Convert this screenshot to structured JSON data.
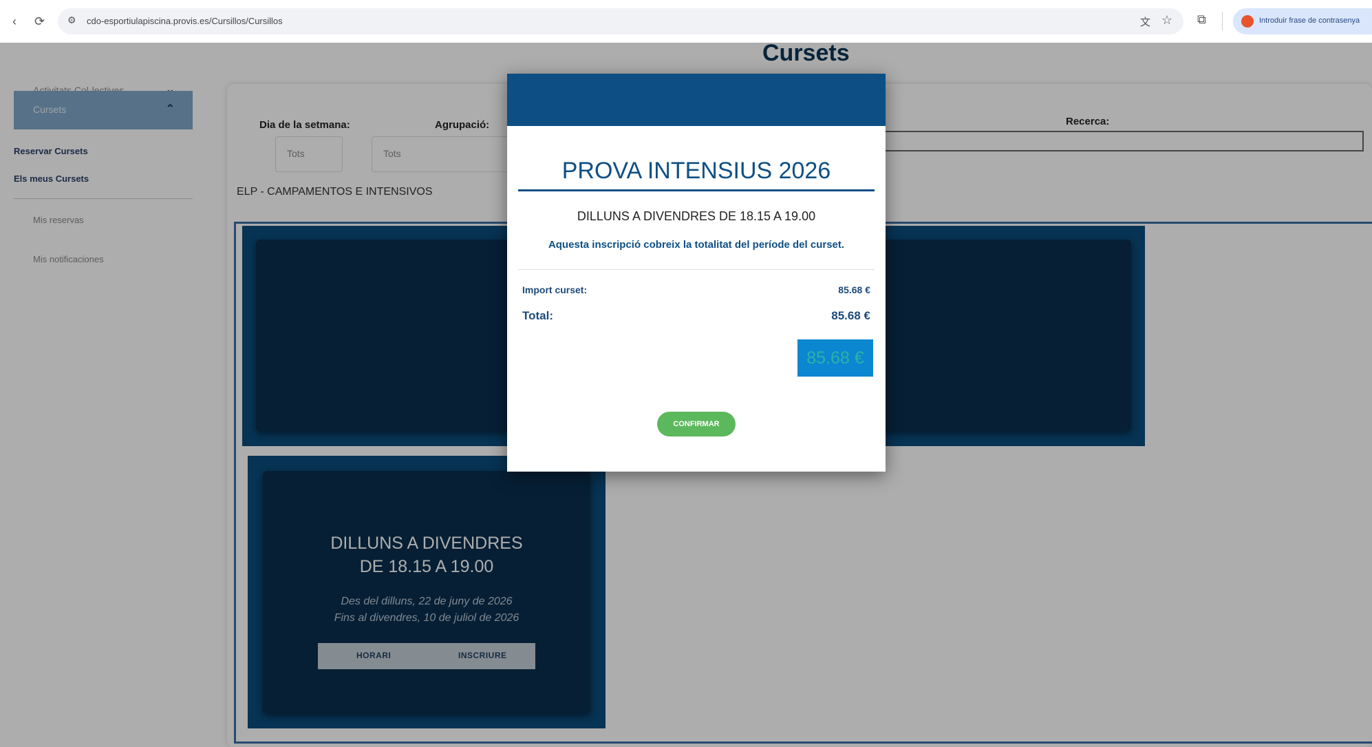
{
  "browser": {
    "url": "cdo-esportiulapiscina.provis.es/Cursillos/Cursillos",
    "profile_text": "Introduir frase de contrasenya"
  },
  "sidebar": {
    "items": [
      {
        "label": "Activitats Col·lectives"
      },
      {
        "label": "Cursets"
      }
    ],
    "subitems": [
      "Reservar Cursets",
      "Els meus Cursets"
    ],
    "links": [
      "Mis reservas",
      "Mis notificaciones"
    ]
  },
  "page": {
    "title": "Cursets",
    "filters": {
      "day_label": "Dia de la setmana:",
      "day_value": "Tots",
      "group_label": "Agrupació:",
      "group_value": "Tots",
      "search_label": "Recerca:"
    },
    "group_title": "ELP - CAMPAMENTOS E INTENSIVOS",
    "card": {
      "title_line1": "DILLUNS A DIVENDRES",
      "title_line2": "DE 18.15 A 19.00",
      "date_from": "Des del dilluns, 22 de juny de 2026",
      "date_to": "Fins al divendres, 10 de juliol de 2026",
      "btn_horari": "HORARI",
      "btn_inscriure": "INSCRIURE"
    }
  },
  "modal": {
    "title": "PROVA INTENSIUS 2026",
    "schedule": "DILLUNS A DIVENDRES DE 18.15 A 19.00",
    "note": "Aquesta inscripció cobreix la totalitat del període del curset.",
    "import_label": "Import curset:",
    "import_value": "85.68 €",
    "total_label": "Total:",
    "total_value": "85.68 €",
    "total_button": "85.68 €",
    "confirm_label": "CONFIRMAR"
  }
}
